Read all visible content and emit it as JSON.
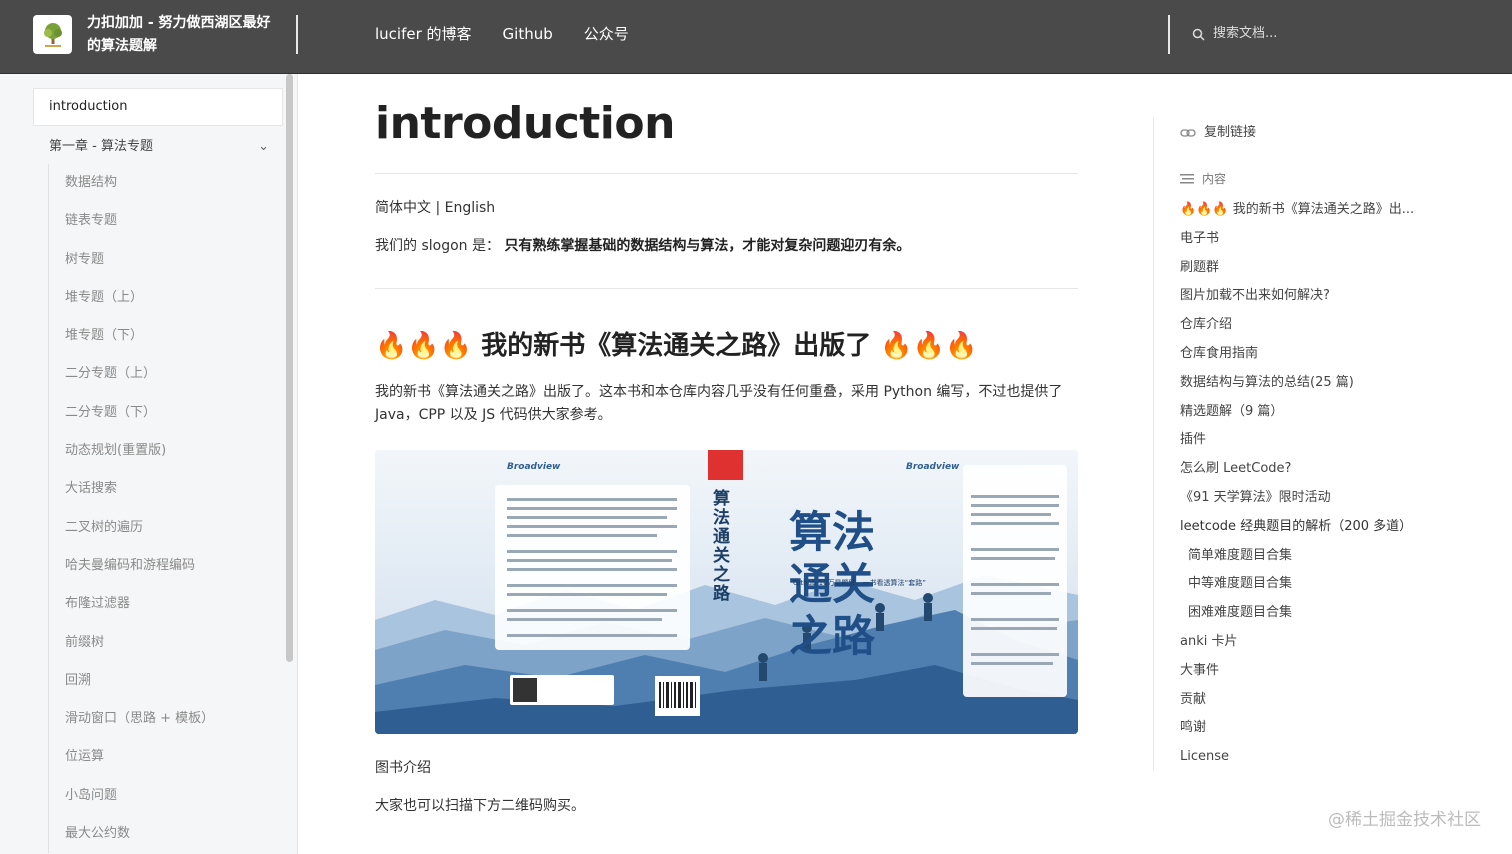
{
  "header": {
    "site_title": "力扣加加 - 努力做西湖区最好的算法题解",
    "nav": [
      "lucifer 的博客",
      "Github",
      "公众号"
    ],
    "search_placeholder": "搜索文档..."
  },
  "sidebar": {
    "active": "introduction",
    "chapter": "第一章 - 算法专题",
    "items": [
      "数据结构",
      "链表专题",
      "树专题",
      "堆专题（上）",
      "堆专题（下）",
      "二分专题（上）",
      "二分专题（下）",
      "动态规划(重置版)",
      "大话搜索",
      "二叉树的遍历",
      "哈夫曼编码和游程编码",
      "布隆过滤器",
      "前缀树",
      "回溯",
      "滑动窗口（思路 + 模板）",
      "位运算",
      "小岛问题",
      "最大公约数"
    ]
  },
  "main": {
    "title": "introduction",
    "lang": "简体中文 | English",
    "slogan_prefix": "我们的 slogon 是：",
    "slogan_bold": "只有熟练掌握基础的数据结构与算法，才能对复杂问题迎刃有余。",
    "heading_fire": "🔥🔥🔥",
    "heading_text": "我的新书《算法通关之路》出版了",
    "para": "我的新书《算法通关之路》出版了。这本书和本仓库内容几乎没有任何重叠，采用 Python 编写，不过也提供了 Java，CPP 以及 JS 代码供大家参考。",
    "book_cover_title": "算法通关之路",
    "book_spine": "算法通关之路",
    "book_publisher": "Broadview",
    "book_slogan": "Github 10万星题解，一书看透算法“套路”",
    "caption": "图书介绍",
    "buy": "大家也可以扫描下方二维码购买。"
  },
  "toc": {
    "copy_link": "复制链接",
    "head": "内容",
    "items": [
      {
        "label": "🔥🔥🔥 我的新书《算法通关之路》出...",
        "level": 0
      },
      {
        "label": "电子书",
        "level": 0
      },
      {
        "label": "刷题群",
        "level": 0
      },
      {
        "label": "图片加载不出来如何解决?",
        "level": 0
      },
      {
        "label": "仓库介绍",
        "level": 0
      },
      {
        "label": "仓库食用指南",
        "level": 0
      },
      {
        "label": "数据结构与算法的总结(25 篇)",
        "level": 0
      },
      {
        "label": "精选题解（9 篇）",
        "level": 0
      },
      {
        "label": "插件",
        "level": 0
      },
      {
        "label": "怎么刷 LeetCode?",
        "level": 0
      },
      {
        "label": "《91 天学算法》限时活动",
        "level": 0
      },
      {
        "label": "leetcode 经典题目的解析（200 多道）",
        "level": 0
      },
      {
        "label": "简单难度题目合集",
        "level": 1
      },
      {
        "label": "中等难度题目合集",
        "level": 1
      },
      {
        "label": "困难难度题目合集",
        "level": 1
      },
      {
        "label": "anki 卡片",
        "level": 0
      },
      {
        "label": "大事件",
        "level": 0
      },
      {
        "label": "贡献",
        "level": 0
      },
      {
        "label": "鸣谢",
        "level": 0
      },
      {
        "label": "License",
        "level": 0
      }
    ]
  },
  "watermark": "@稀土掘金技术社区",
  "colors": {
    "header_bg": "#4a4a4a",
    "sidebar_bg": "#f5f6f7",
    "book_blue": "#3e6f9f"
  }
}
